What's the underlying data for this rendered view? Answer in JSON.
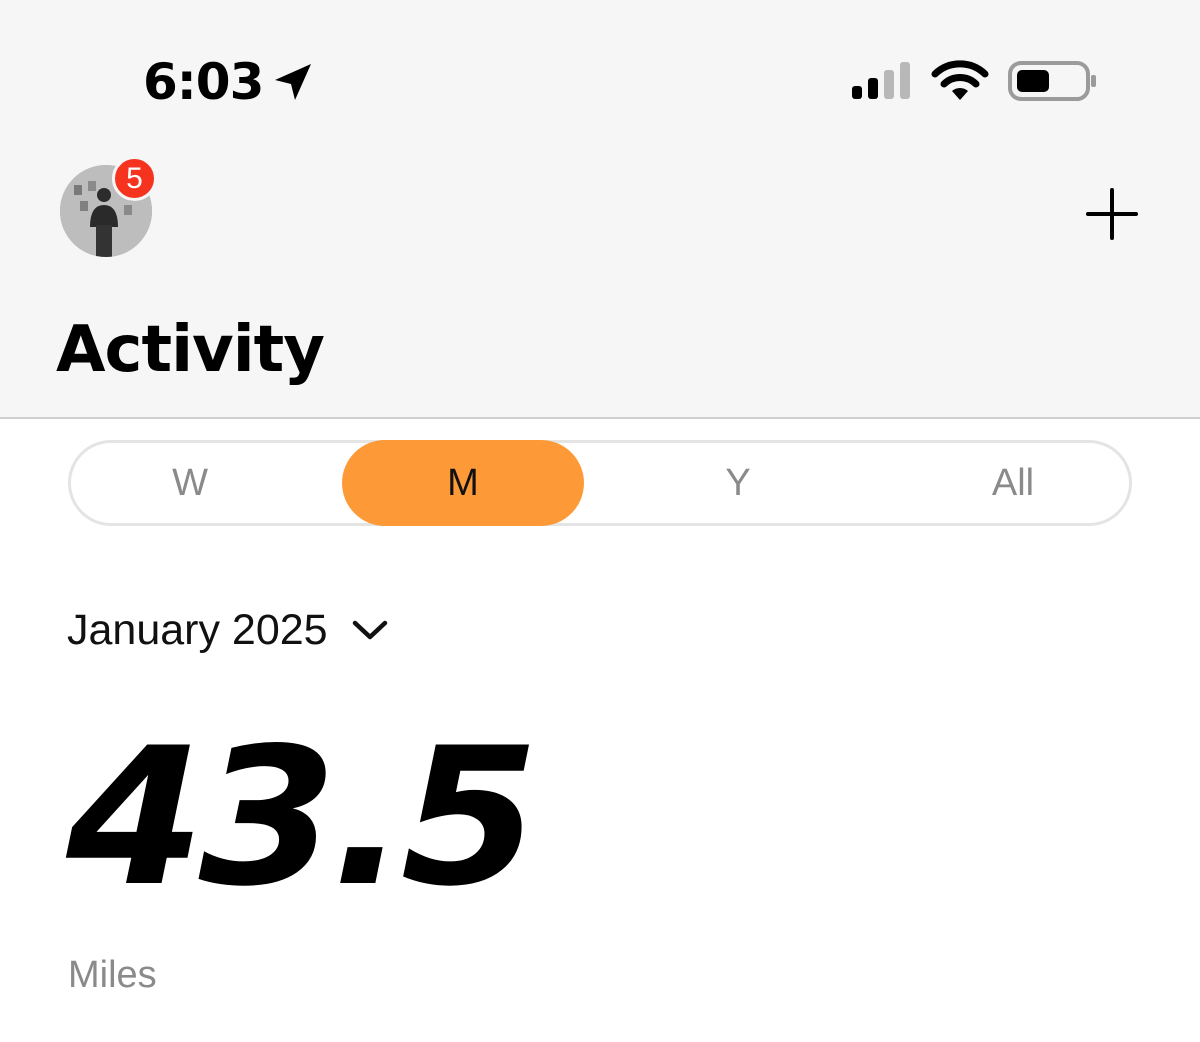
{
  "status_bar": {
    "time": "6:03",
    "icons": [
      "location-arrow-icon",
      "cellular-signal-icon",
      "wifi-icon",
      "battery-icon"
    ]
  },
  "header": {
    "avatar": "profile-avatar",
    "notification_count": "5",
    "add_icon": "plus-icon",
    "title": "Activity"
  },
  "segments": {
    "items": [
      {
        "label": "W",
        "selected": false
      },
      {
        "label": "M",
        "selected": true
      },
      {
        "label": "Y",
        "selected": false
      },
      {
        "label": "All",
        "selected": false
      }
    ]
  },
  "period": {
    "label": "January 2025",
    "icon": "chevron-down-icon"
  },
  "summary": {
    "value": "43.5",
    "unit": "Miles"
  },
  "colors": {
    "accent": "#fd9a37",
    "badge": "#f5331f",
    "header_background": "#f6f6f6",
    "muted_text": "#8a8a8a"
  }
}
